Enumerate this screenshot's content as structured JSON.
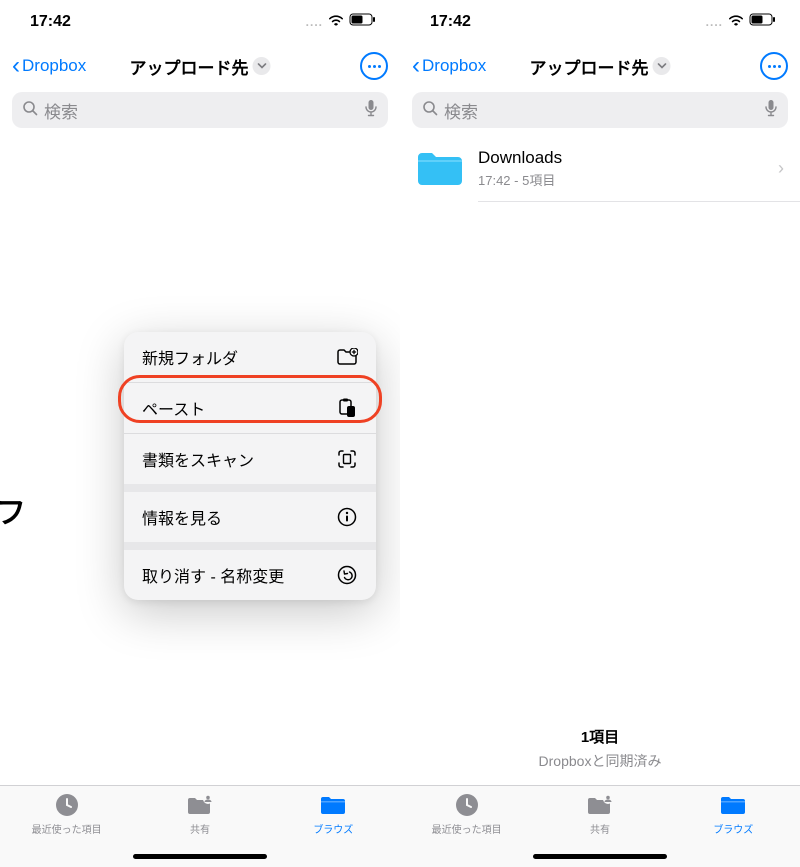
{
  "left": {
    "status": {
      "time": "17:42"
    },
    "nav": {
      "back": "Dropbox",
      "title": "アップロード先"
    },
    "search": {
      "placeholder": "検索"
    },
    "menu": {
      "items": [
        {
          "label": "新規フォルダ",
          "icon": "folder-plus"
        },
        {
          "label": "ペースト",
          "icon": "paste",
          "highlighted": true
        },
        {
          "label": "書類をスキャン",
          "icon": "scan"
        },
        {
          "label": "情報を見る",
          "icon": "info"
        },
        {
          "label": "取り消す - 名称変更",
          "icon": "undo"
        }
      ]
    },
    "tabs": {
      "recents": "最近使った項目",
      "shared": "共有",
      "browse": "ブラウズ"
    }
  },
  "right": {
    "status": {
      "time": "17:42"
    },
    "nav": {
      "back": "Dropbox",
      "title": "アップロード先"
    },
    "search": {
      "placeholder": "検索"
    },
    "folder": {
      "name": "Downloads",
      "subtitle": "17:42 - 5項目"
    },
    "summary": {
      "count": "1項目",
      "synced": "Dropboxと同期済み"
    },
    "tabs": {
      "recents": "最近使った項目",
      "shared": "共有",
      "browse": "ブラウズ"
    }
  }
}
